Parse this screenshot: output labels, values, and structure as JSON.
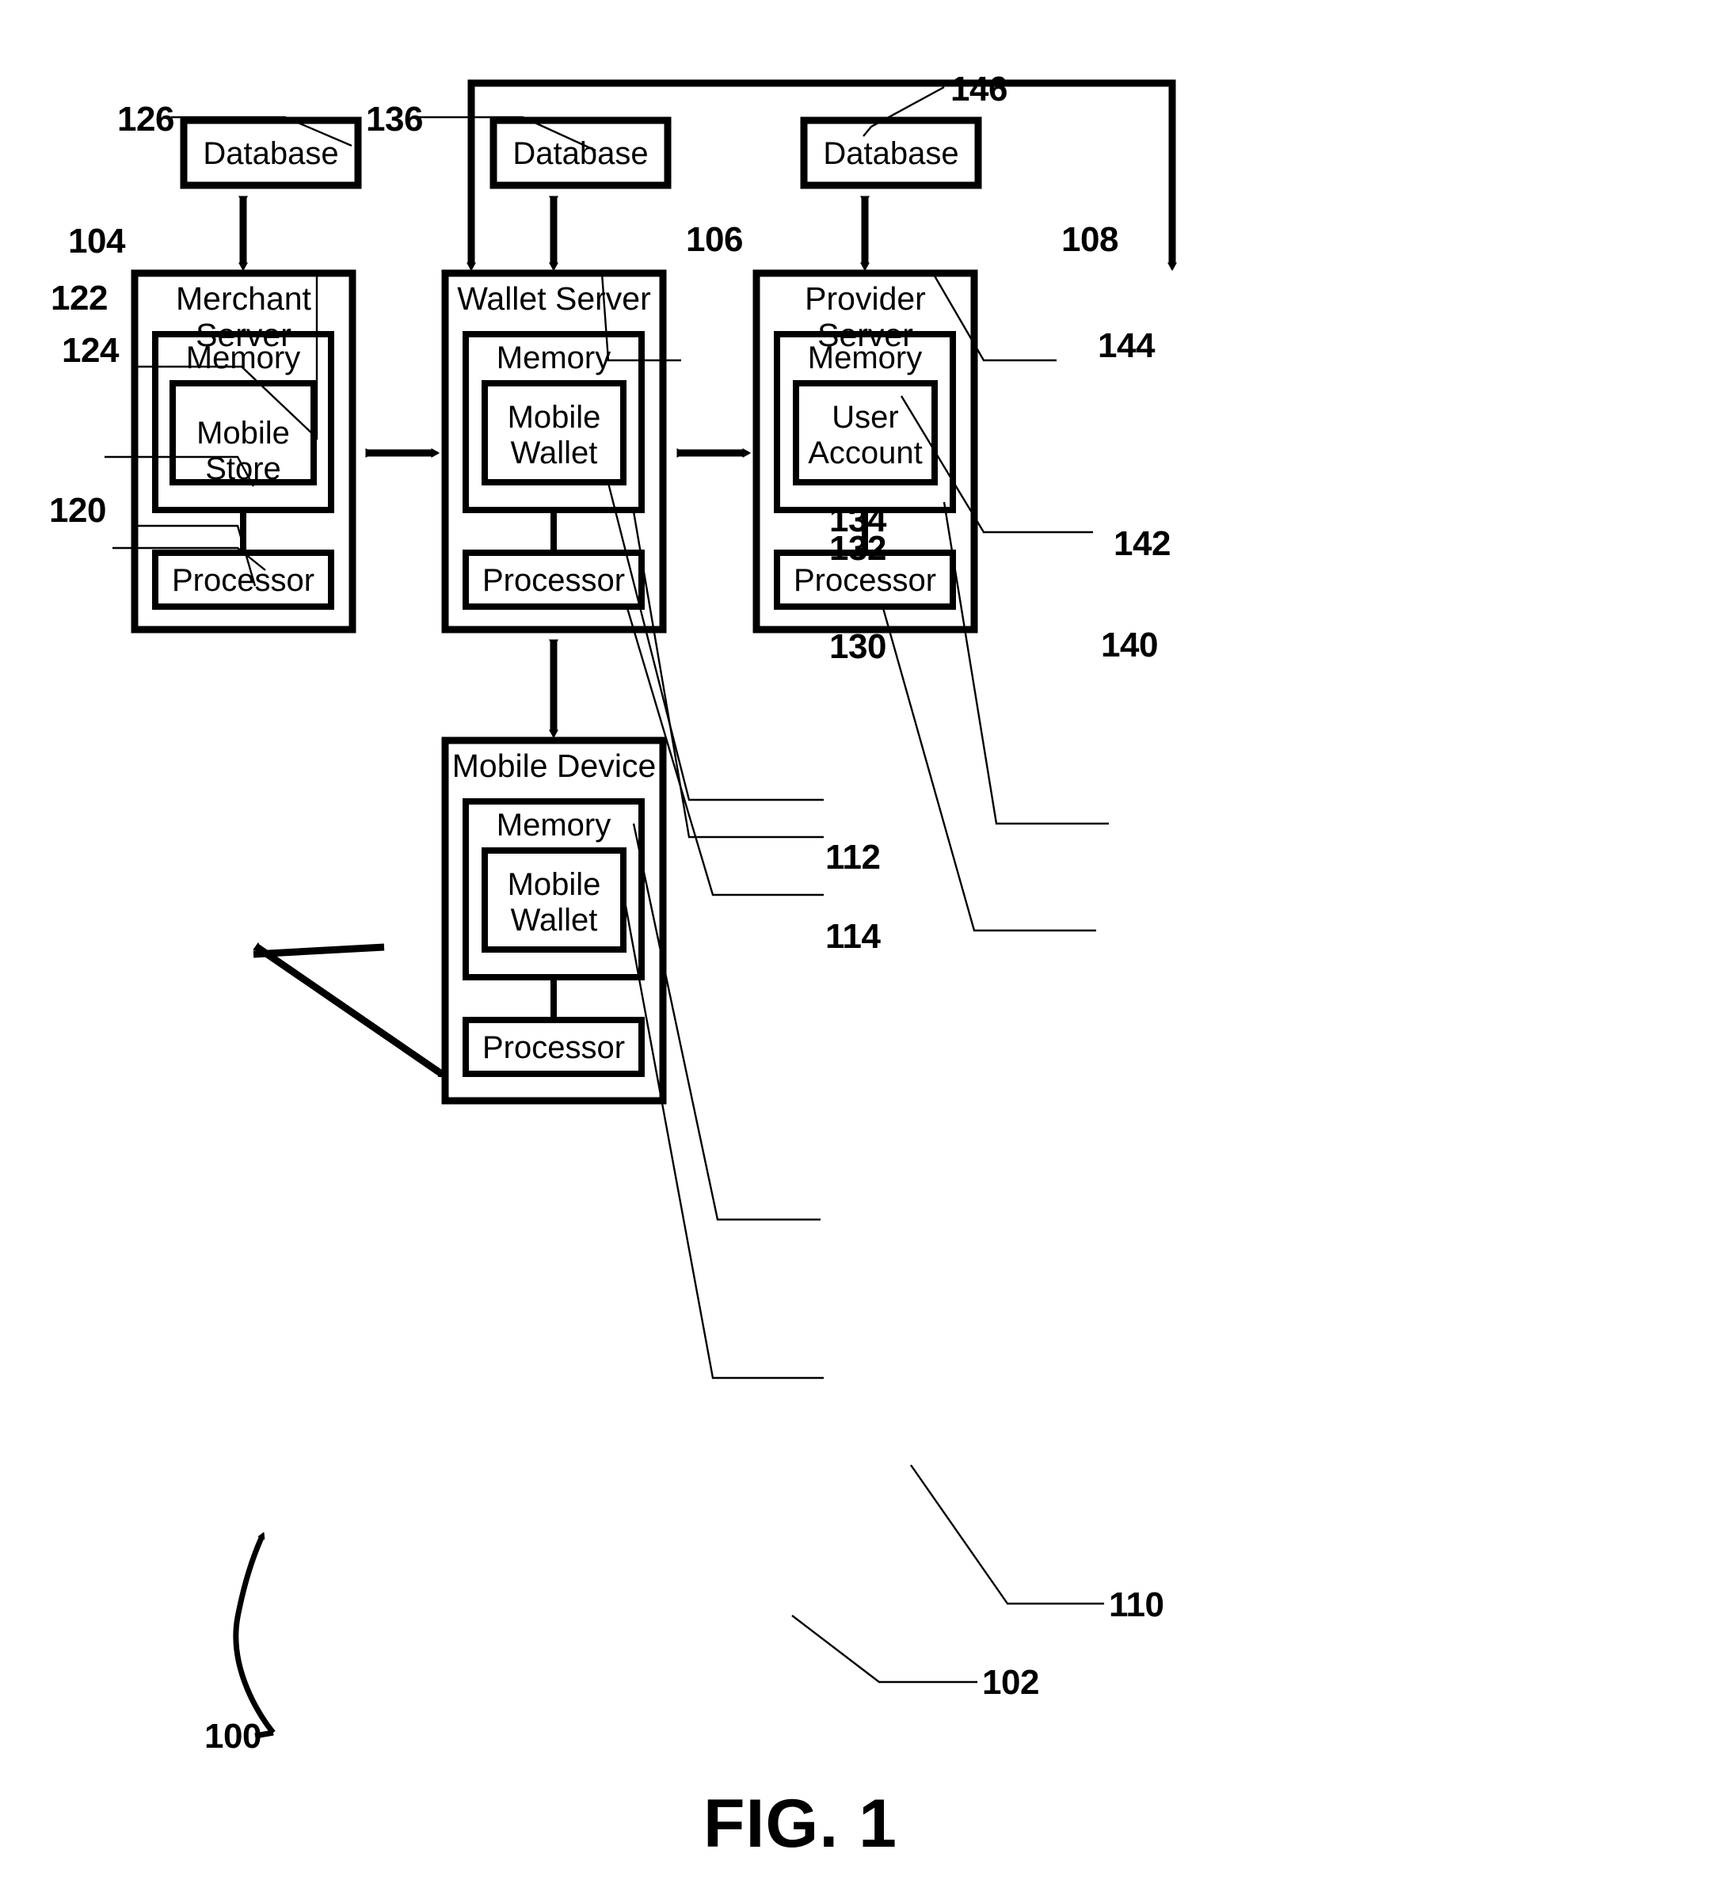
{
  "figure": {
    "caption": "FIG. 1",
    "system_ref": "100"
  },
  "databases": [
    {
      "id": "merchant-database",
      "label": "Database",
      "ref": "126"
    },
    {
      "id": "wallet-database",
      "label": "Database",
      "ref": "136"
    },
    {
      "id": "provider-database",
      "label": "Database",
      "ref": "146"
    }
  ],
  "servers": [
    {
      "id": "merchant-server",
      "title": "Merchant Server",
      "ref": "104",
      "memory": {
        "label": "Memory",
        "ref": "122"
      },
      "module": {
        "label": "Mobile Store",
        "ref": "124"
      },
      "processor": {
        "label": "Processor",
        "ref": "120"
      }
    },
    {
      "id": "wallet-server",
      "title": "Wallet Server",
      "ref": "106",
      "memory": {
        "label": "Memory",
        "ref": "132"
      },
      "module": {
        "label": "Mobile\nWallet",
        "ref": "134"
      },
      "processor": {
        "label": "Processor",
        "ref": "130"
      }
    },
    {
      "id": "provider-server",
      "title": "Provider Server",
      "ref": "108",
      "memory": {
        "label": "Memory",
        "ref": "142"
      },
      "module": {
        "label": "User\nAccount",
        "ref": "144"
      },
      "processor": {
        "label": "Processor",
        "ref": "140"
      }
    }
  ],
  "mobile_device": {
    "id": "mobile-device",
    "title": "Mobile Device",
    "ref": "102",
    "memory": {
      "label": "Memory",
      "ref": "112"
    },
    "module": {
      "label": "Mobile\nWallet",
      "ref": "114"
    },
    "processor": {
      "label": "Processor",
      "ref": "110"
    }
  },
  "colors": {
    "stroke": "#000000",
    "background": "#ffffff",
    "leader": "#000000"
  }
}
